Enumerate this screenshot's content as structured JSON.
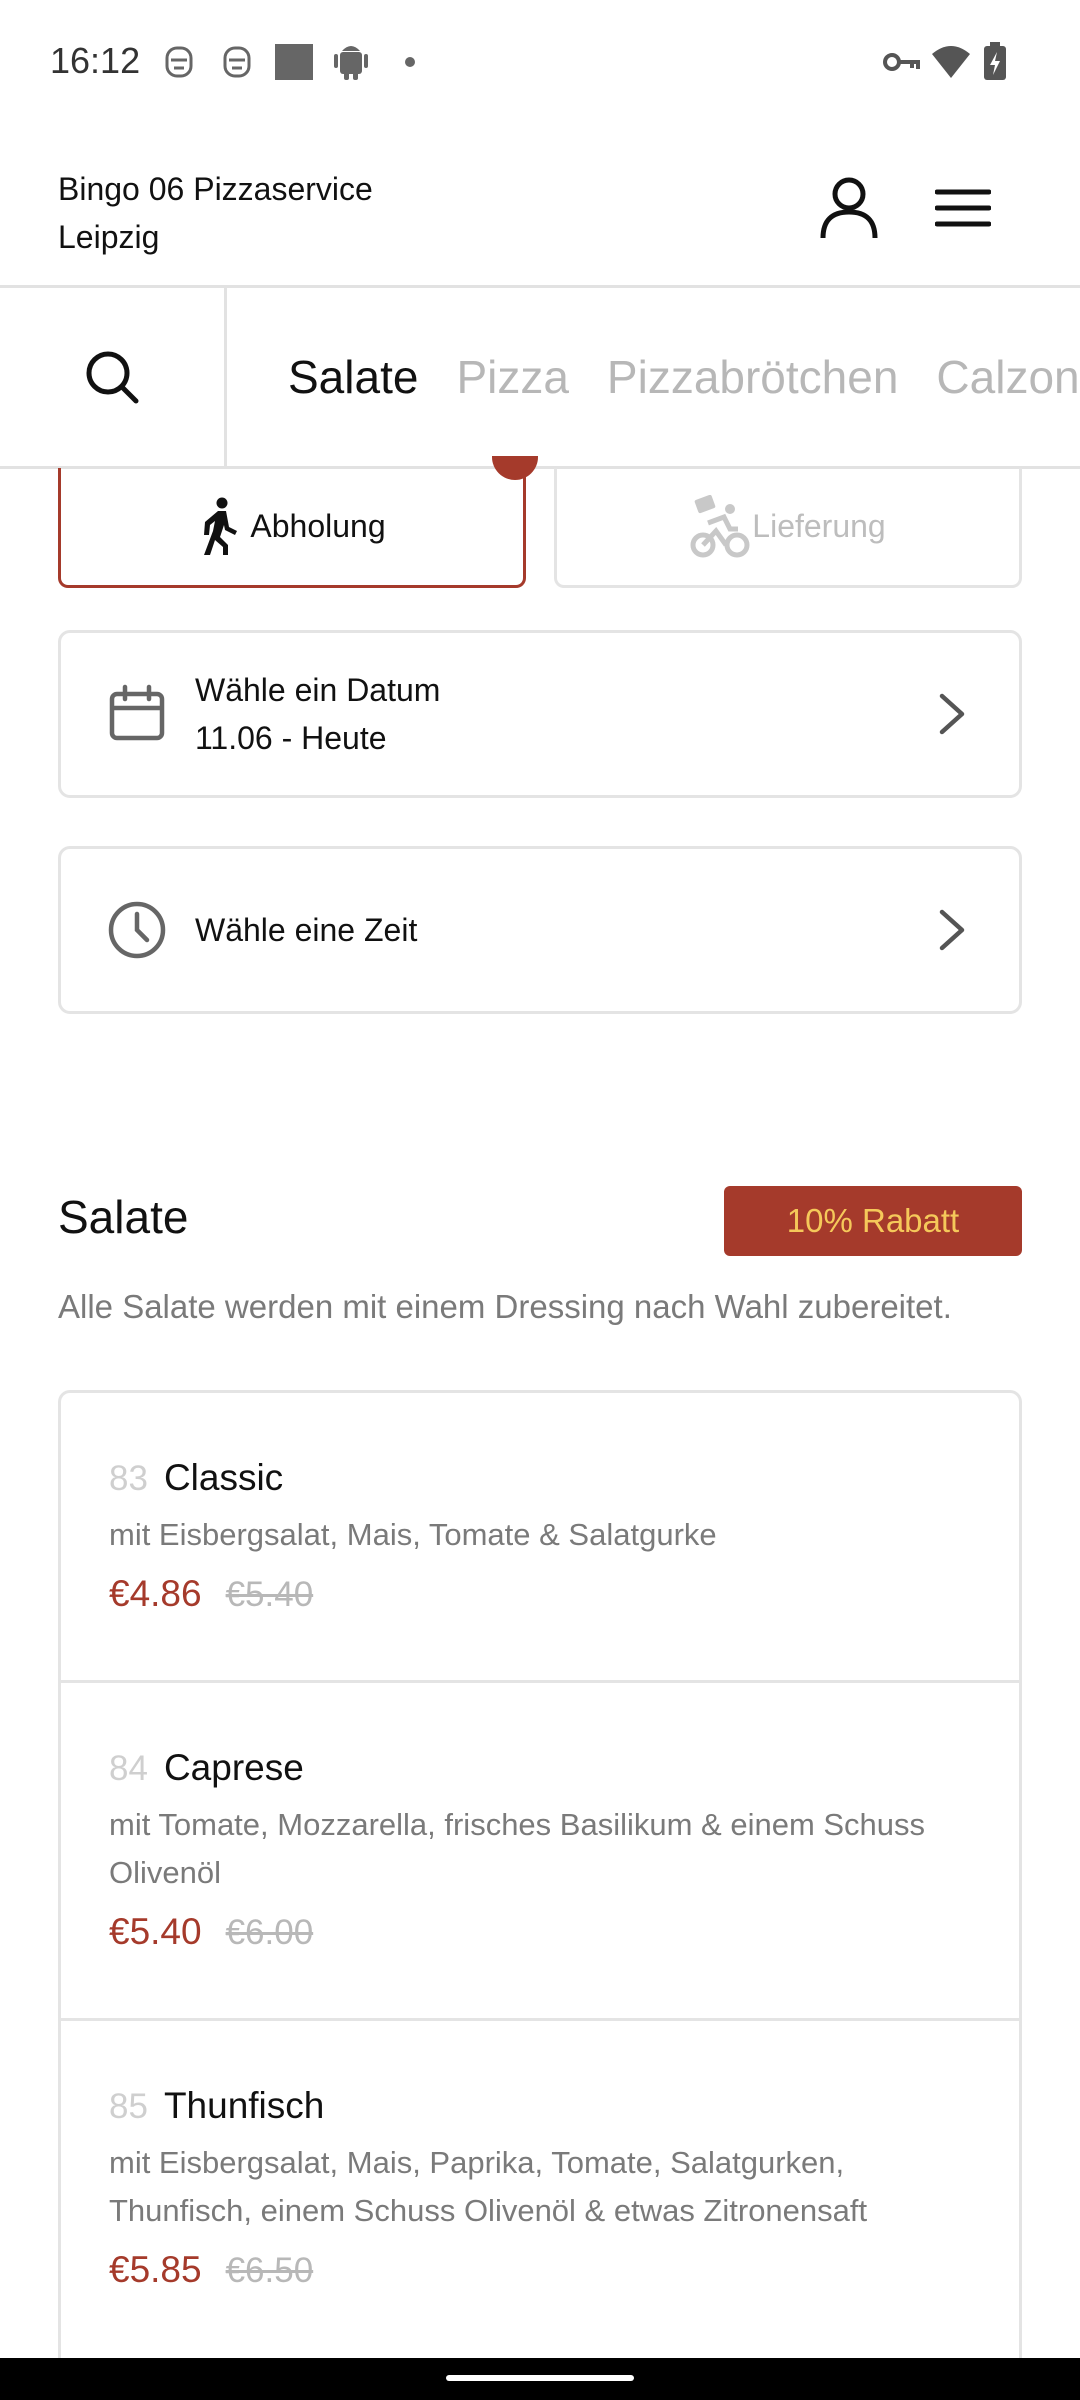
{
  "status_bar": {
    "time": "16:12",
    "left_icons": [
      "notification-icon-1",
      "notification-icon-2",
      "image-icon",
      "android-icon",
      "dot-icon"
    ],
    "right_icons": [
      "vpn-key-icon",
      "wifi-icon",
      "battery-charging-icon"
    ]
  },
  "header": {
    "shop_name": "Bingo 06 Pizzaservice",
    "city": "Leipzig"
  },
  "tabs": {
    "items": [
      "Salate",
      "Pizza",
      "Pizzabrötchen",
      "Calzon"
    ],
    "active": "Salate"
  },
  "order_mode": {
    "pickup_label": "Abholung",
    "delivery_label": "Lieferung",
    "selected": "Abholung"
  },
  "date_selector": {
    "label": "Wähle ein Datum",
    "value": "11.06 - Heute"
  },
  "time_selector": {
    "label": "Wähle eine Zeit"
  },
  "section": {
    "title": "Salate",
    "discount_badge": "10% Rabatt",
    "description": "Alle Salate werden mit einem Dressing nach Wahl zubereitet."
  },
  "products": [
    {
      "number": "83",
      "name": "Classic",
      "description": "mit Eisbergsalat, Mais, Tomate & Salatgurke",
      "price": "€4.86",
      "old_price": "€5.40"
    },
    {
      "number": "84",
      "name": "Caprese",
      "description": "mit Tomate, Mozzarella, frisches Basilikum & einem Schuss Olivenöl",
      "price": "€5.40",
      "old_price": "€6.00"
    },
    {
      "number": "85",
      "name": "Thunfisch",
      "description": "mit Eisbergsalat, Mais, Paprika, Tomate, Salatgurken, Thunfisch, einem Schuss Olivenöl & etwas Zitronensaft",
      "price": "€5.85",
      "old_price": "€6.50"
    }
  ],
  "colors": {
    "accent": "#a53a2b",
    "discount_text": "#f5c85a",
    "border": "#e4e4e4",
    "muted_text": "#7a7a7a",
    "inactive_tab": "#b7b7b7"
  }
}
